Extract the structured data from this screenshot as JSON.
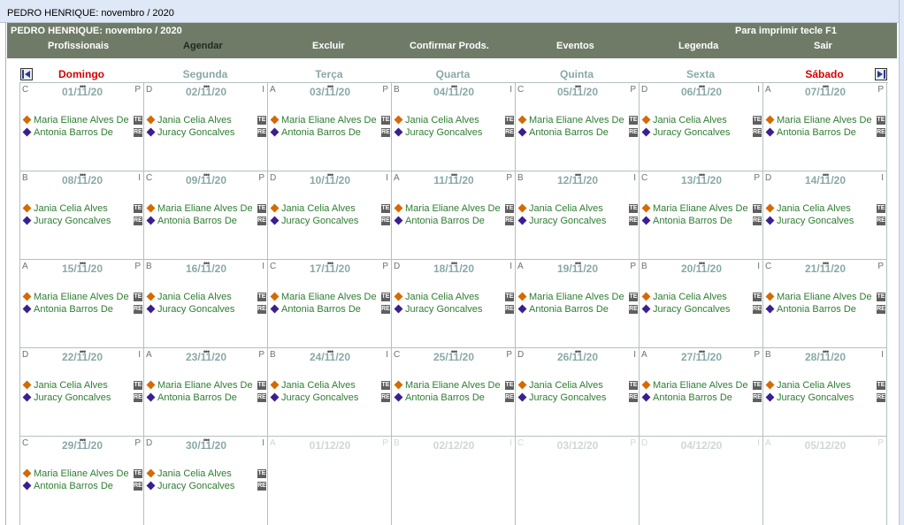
{
  "window": {
    "title": "PEDRO HENRIQUE: novembro / 2020"
  },
  "toolbar": {
    "title": "PEDRO HENRIQUE: novembro / 2020",
    "print_hint": "Para imprimir tecle F1",
    "menu": [
      "Profissionais",
      "Agendar",
      "Excluir",
      "Confirmar Prods.",
      "Eventos",
      "Legenda",
      "Sair"
    ]
  },
  "weekdays": [
    "Domingo",
    "Segunda",
    "Terça",
    "Quarta",
    "Quinta",
    "Sexta",
    "Sábado"
  ],
  "colors": {
    "toolbar": "#6f7b67",
    "weekday": "#8aa8a8",
    "weekend": "#d60000",
    "entry_text": "#2e7d32",
    "diamond_orange": "#d46a00",
    "diamond_purple": "#3a1f8f"
  },
  "nav": {
    "prev_icon": "arrow-left-icon",
    "next_icon": "arrow-right-icon"
  },
  "entries_set_a": [
    {
      "name": "Maria Eliane Alves De",
      "badge": "TE",
      "color": "orange"
    },
    {
      "name": "Antonia Barros De",
      "badge": "RE",
      "color": "purple"
    }
  ],
  "entries_set_b": [
    {
      "name": "Jania Celia Alves",
      "badge": "TE",
      "color": "orange"
    },
    {
      "name": "Juracy Goncalves",
      "badge": "RE",
      "color": "purple"
    }
  ],
  "calendar": {
    "month": "novembro / 2020",
    "weeks": [
      [
        {
          "date": "01/11/20",
          "left": "C",
          "right": "P",
          "set": "a"
        },
        {
          "date": "02/11/20",
          "left": "D",
          "right": "I",
          "set": "b"
        },
        {
          "date": "03/11/20",
          "left": "A",
          "right": "P",
          "set": "a"
        },
        {
          "date": "04/11/20",
          "left": "B",
          "right": "I",
          "set": "b"
        },
        {
          "date": "05/11/20",
          "left": "C",
          "right": "P",
          "set": "a"
        },
        {
          "date": "06/11/20",
          "left": "D",
          "right": "I",
          "set": "b"
        },
        {
          "date": "07/11/20",
          "left": "A",
          "right": "P",
          "set": "a"
        }
      ],
      [
        {
          "date": "08/11/20",
          "left": "B",
          "right": "I",
          "set": "b"
        },
        {
          "date": "09/11/20",
          "left": "C",
          "right": "P",
          "set": "a"
        },
        {
          "date": "10/11/20",
          "left": "D",
          "right": "I",
          "set": "b"
        },
        {
          "date": "11/11/20",
          "left": "A",
          "right": "P",
          "set": "a"
        },
        {
          "date": "12/11/20",
          "left": "B",
          "right": "I",
          "set": "b"
        },
        {
          "date": "13/11/20",
          "left": "C",
          "right": "P",
          "set": "a"
        },
        {
          "date": "14/11/20",
          "left": "D",
          "right": "I",
          "set": "b"
        }
      ],
      [
        {
          "date": "15/11/20",
          "left": "A",
          "right": "P",
          "set": "a"
        },
        {
          "date": "16/11/20",
          "left": "B",
          "right": "I",
          "set": "b"
        },
        {
          "date": "17/11/20",
          "left": "C",
          "right": "P",
          "set": "a"
        },
        {
          "date": "18/11/20",
          "left": "D",
          "right": "I",
          "set": "b"
        },
        {
          "date": "19/11/20",
          "left": "A",
          "right": "P",
          "set": "a"
        },
        {
          "date": "20/11/20",
          "left": "B",
          "right": "I",
          "set": "b"
        },
        {
          "date": "21/11/20",
          "left": "C",
          "right": "P",
          "set": "a"
        }
      ],
      [
        {
          "date": "22/11/20",
          "left": "D",
          "right": "I",
          "set": "b"
        },
        {
          "date": "23/11/20",
          "left": "A",
          "right": "P",
          "set": "a"
        },
        {
          "date": "24/11/20",
          "left": "B",
          "right": "I",
          "set": "b"
        },
        {
          "date": "25/11/20",
          "left": "C",
          "right": "P",
          "set": "a"
        },
        {
          "date": "26/11/20",
          "left": "D",
          "right": "I",
          "set": "b"
        },
        {
          "date": "27/11/20",
          "left": "A",
          "right": "P",
          "set": "a"
        },
        {
          "date": "28/11/20",
          "left": "B",
          "right": "I",
          "set": "b"
        }
      ],
      [
        {
          "date": "29/11/20",
          "left": "C",
          "right": "P",
          "set": "a"
        },
        {
          "date": "30/11/20",
          "left": "D",
          "right": "I",
          "set": "b"
        },
        {
          "date": "01/12/20",
          "left": "A",
          "right": "P",
          "set": "none",
          "faded": true
        },
        {
          "date": "02/12/20",
          "left": "B",
          "right": "I",
          "set": "none",
          "faded": true
        },
        {
          "date": "03/12/20",
          "left": "C",
          "right": "P",
          "set": "none",
          "faded": true
        },
        {
          "date": "04/12/20",
          "left": "D",
          "right": "I",
          "set": "none",
          "faded": true
        },
        {
          "date": "05/12/20",
          "left": "A",
          "right": "P",
          "set": "none",
          "faded": true
        }
      ]
    ]
  }
}
